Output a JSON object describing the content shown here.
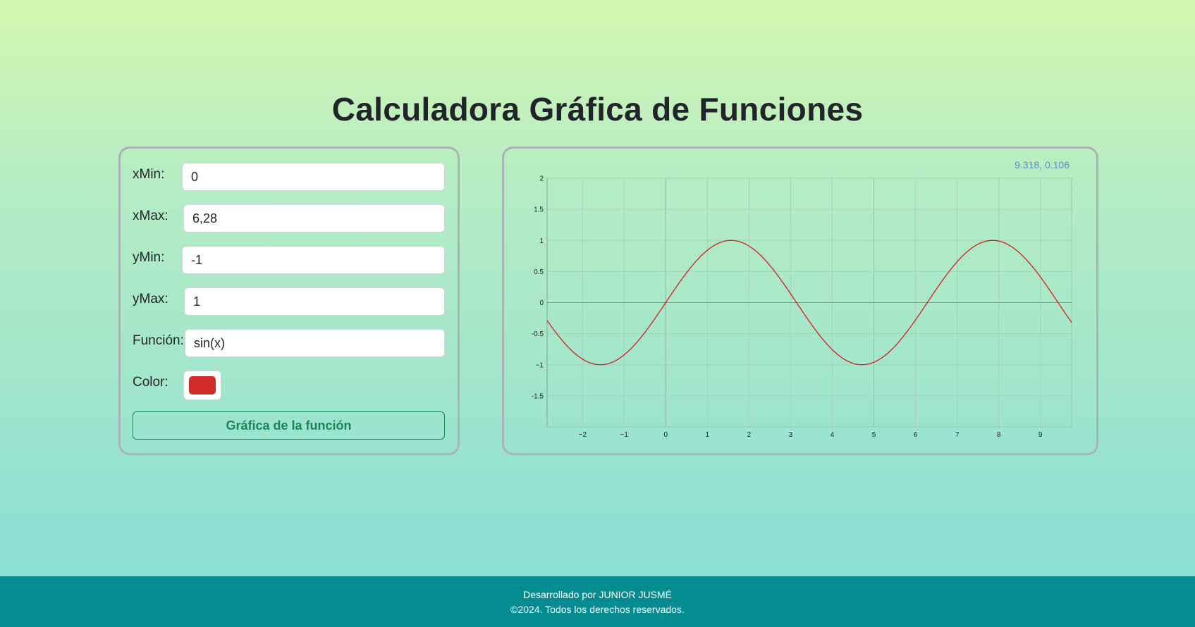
{
  "page": {
    "title": "Calculadora Gráfica de Funciones"
  },
  "form": {
    "xmin": {
      "label": "xMin:",
      "value": "0"
    },
    "xmax": {
      "label": "xMax:",
      "value": "6,28"
    },
    "ymin": {
      "label": "yMin:",
      "value": "-1"
    },
    "ymax": {
      "label": "yMax:",
      "value": "1"
    },
    "funcion": {
      "label": "Función:",
      "value": "sin(x)"
    },
    "color": {
      "label": "Color:",
      "value": "#d22b2b"
    },
    "button_label": "Gráfica de la función"
  },
  "graph": {
    "cursor_coords": "9.318, 0.106"
  },
  "chart_data": {
    "type": "line",
    "function": "sin(x)",
    "series": [
      {
        "function": "sin(x)",
        "color": "#d22b2b"
      }
    ],
    "xlim": [
      -2.85,
      9.75
    ],
    "ylim": [
      -2,
      2
    ],
    "x_ticks": [
      "−2",
      "−1",
      "0",
      "1",
      "2",
      "3",
      "4",
      "5",
      "6",
      "7",
      "8",
      "9"
    ],
    "y_ticks": [
      "2",
      "1.5",
      "1",
      "0.5",
      "0",
      "-0.5",
      "−1",
      "-1.5"
    ],
    "grid": true,
    "title": "",
    "xlabel": "",
    "ylabel": ""
  },
  "footer": {
    "line1": "Desarrollado por JUNIOR JUSMÉ",
    "line2": "©2024. Todos los derechos reservados."
  }
}
